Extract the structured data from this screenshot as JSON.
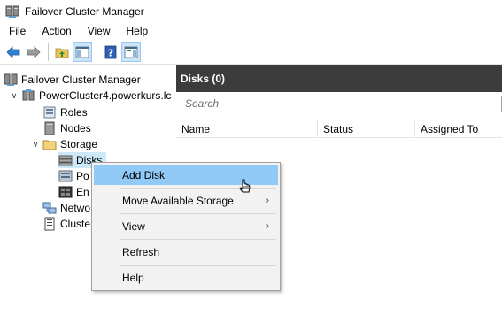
{
  "window": {
    "title": "Failover Cluster Manager"
  },
  "menu": [
    "File",
    "Action",
    "View",
    "Help"
  ],
  "toolbar": {
    "buttons": [
      "back-arrow-icon",
      "forward-arrow-icon",
      "up-folder-icon",
      "show-hide-console-tree-icon",
      "help-icon",
      "show-hide-action-pane-icon"
    ]
  },
  "tree": {
    "root": "Failover Cluster Manager",
    "cluster": "PowerCluster4.powerkurs.lc",
    "roles": "Roles",
    "nodes": "Nodes",
    "storage": "Storage",
    "disks": "Disks",
    "pools": "Po",
    "enclosures": "En",
    "networks": "Netwo",
    "cluster_events": "Cluste"
  },
  "content": {
    "header": "Disks (0)",
    "search_placeholder": "Search",
    "columns": [
      "Name",
      "Status",
      "Assigned To"
    ]
  },
  "context_menu": {
    "items": [
      {
        "label": "Add Disk",
        "submenu": false,
        "hover": true
      },
      {
        "label": "Move Available Storage",
        "submenu": true,
        "hover": false
      },
      {
        "label": "View",
        "submenu": true,
        "hover": false
      },
      {
        "label": "Refresh",
        "submenu": false,
        "hover": false
      },
      {
        "label": "Help",
        "submenu": false,
        "hover": false
      }
    ],
    "submenu_arrow": "›"
  },
  "colors": {
    "header_bg": "#3c3c3c",
    "menu_hover": "#91c9f7",
    "selection": "#cde8f7"
  }
}
